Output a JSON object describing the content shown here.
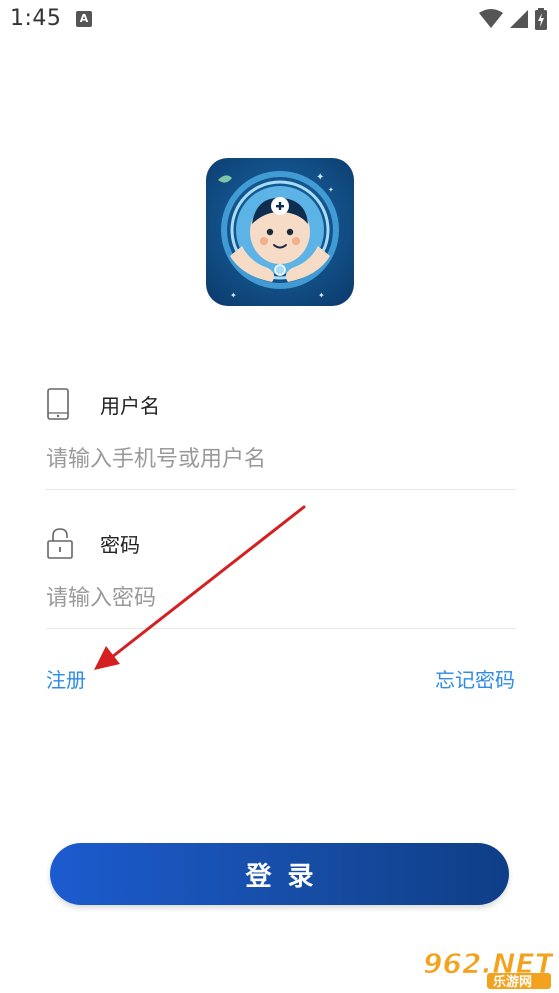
{
  "status_bar": {
    "time": "1:45",
    "notification_badge": "A"
  },
  "form": {
    "username": {
      "label": "用户名",
      "placeholder": "请输入手机号或用户名"
    },
    "password": {
      "label": "密码",
      "placeholder": "请输入密码"
    }
  },
  "links": {
    "register": "注册",
    "forgot_password": "忘记密码"
  },
  "login_button": "登录",
  "watermark": {
    "brand": "962.NET",
    "subtitle": "乐游网"
  },
  "colors": {
    "accent": "#2d8ce8",
    "button_start": "#1c5bd0",
    "button_end": "#0e3e86",
    "arrow": "#d42020"
  }
}
